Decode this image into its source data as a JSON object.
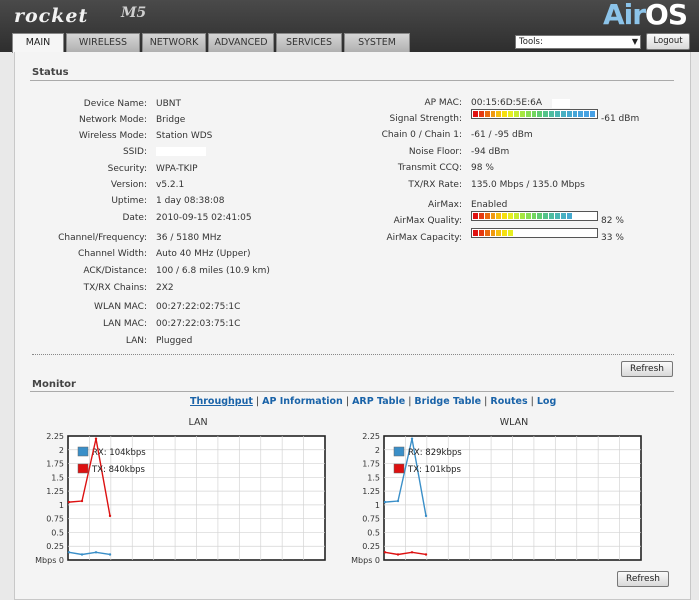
{
  "header": {
    "brand": "rocket",
    "model": "M5",
    "os_brand_air": "Air",
    "os_brand_os": "OS",
    "tabs": [
      {
        "label": "MAIN",
        "active": true
      },
      {
        "label": "WIRELESS"
      },
      {
        "label": "NETWORK"
      },
      {
        "label": "ADVANCED"
      },
      {
        "label": "SERVICES"
      },
      {
        "label": "SYSTEM"
      }
    ],
    "tools_label": "Tools:",
    "logout_label": "Logout"
  },
  "status": {
    "title": "Status",
    "left": [
      {
        "label": "Device Name:",
        "value": "UBNT"
      },
      {
        "label": "Network Mode:",
        "value": "Bridge"
      },
      {
        "label": "Wireless Mode:",
        "value": "Station WDS"
      },
      {
        "label": "SSID:",
        "value": ""
      },
      {
        "label": "Security:",
        "value": "WPA-TKIP"
      },
      {
        "label": "Version:",
        "value": "v5.2.1"
      },
      {
        "label": "Uptime:",
        "value": "1 day 08:38:08"
      },
      {
        "label": "Date:",
        "value": "2010-09-15 02:41:05"
      },
      {
        "label": "Channel/Frequency:",
        "value": "36 / 5180 MHz"
      },
      {
        "label": "Channel Width:",
        "value": "Auto 40 MHz (Upper)"
      },
      {
        "label": "ACK/Distance:",
        "value": "100 / 6.8 miles (10.9 km)"
      },
      {
        "label": "TX/RX Chains:",
        "value": "2X2"
      },
      {
        "label": "WLAN MAC:",
        "value": "00:27:22:02:75:1C"
      },
      {
        "label": "LAN MAC:",
        "value": "00:27:22:03:75:1C"
      },
      {
        "label": "LAN:",
        "value": "Plugged"
      }
    ],
    "right": [
      {
        "label": "AP MAC:",
        "value": "00:15:6D:5E:6A"
      },
      {
        "label": "Signal Strength:",
        "value": "-61 dBm"
      },
      {
        "label": "Chain 0 / Chain 1:",
        "value": "-61 / -95 dBm"
      },
      {
        "label": "Noise Floor:",
        "value": "-94 dBm"
      },
      {
        "label": "Transmit CCQ:",
        "value": "98 %"
      },
      {
        "label": "TX/RX Rate:",
        "value": "135.0 Mbps / 135.0 Mbps"
      },
      {
        "label": "AirMax:",
        "value": "Enabled"
      },
      {
        "label": "AirMax Quality:",
        "value": "82 %"
      },
      {
        "label": "AirMax Capacity:",
        "value": "33 %"
      }
    ],
    "meters": {
      "signal_fraction": 1.0,
      "quality_fraction": 0.82,
      "capacity_fraction": 0.33
    },
    "refresh_label": "Refresh"
  },
  "monitor": {
    "title": "Monitor",
    "links": [
      "Throughput",
      "AP Information",
      "ARP Table",
      "Bridge Table",
      "Routes",
      "Log"
    ],
    "refresh_label": "Refresh"
  },
  "chart_data": [
    {
      "type": "line",
      "title": "LAN",
      "ylabel": "Mbps",
      "yticks": [
        "0",
        "0.25",
        "0.5",
        "0.75",
        "1",
        "1.25",
        "1.5",
        "1.75",
        "2",
        "2.25"
      ],
      "ylim": [
        0,
        2.25
      ],
      "grid": true,
      "legend_position": "top-left",
      "series": [
        {
          "name": "RX: 104kbps",
          "color": "#3a8fc8",
          "values": [
            0.14,
            0.1,
            0.14,
            0.1
          ]
        },
        {
          "name": "TX: 840kbps",
          "color": "#dd1111",
          "values": [
            1.05,
            1.07,
            2.2,
            0.8
          ]
        }
      ]
    },
    {
      "type": "line",
      "title": "WLAN",
      "ylabel": "Mbps",
      "yticks": [
        "0",
        "0.25",
        "0.5",
        "0.75",
        "1",
        "1.25",
        "1.5",
        "1.75",
        "2",
        "2.25"
      ],
      "ylim": [
        0,
        2.25
      ],
      "grid": true,
      "legend_position": "top-left",
      "series": [
        {
          "name": "RX: 829kbps",
          "color": "#3a8fc8",
          "values": [
            1.05,
            1.07,
            2.2,
            0.8
          ]
        },
        {
          "name": "TX: 101kbps",
          "color": "#dd1111",
          "values": [
            0.14,
            0.1,
            0.14,
            0.1
          ]
        }
      ]
    }
  ]
}
